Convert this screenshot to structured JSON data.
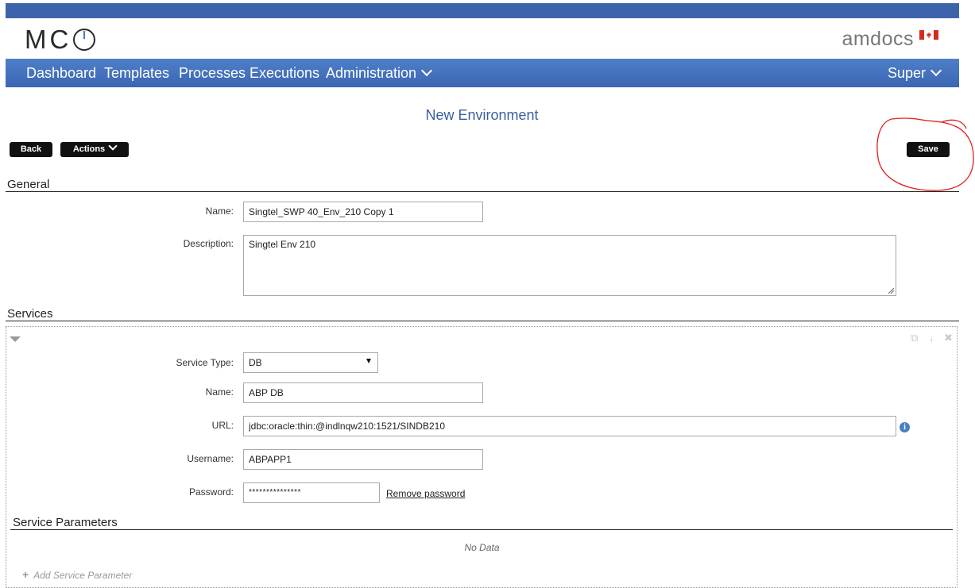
{
  "header": {
    "app_logo": "MCO",
    "brand": "amdocs",
    "brand_color": "#3d63ab",
    "flag_icon": "canada-flag-icon"
  },
  "nav": {
    "items": [
      {
        "label": "Dashboard"
      },
      {
        "label": "Templates"
      },
      {
        "label": "Processes"
      },
      {
        "label": "Executions"
      },
      {
        "label": "Administration"
      }
    ],
    "user": "Super"
  },
  "page": {
    "title": "New Environment",
    "back_label": "Back",
    "actions_label": "Actions",
    "save_label": "Save"
  },
  "general": {
    "heading": "General",
    "name_label": "Name:",
    "name_value": "Singtel_SWP 40_Env_210 Copy 1",
    "description_label": "Description:",
    "description_value": "Singtel Env 210"
  },
  "services": {
    "heading": "Services",
    "service_type_label": "Service Type:",
    "service_type_value": "DB",
    "name_label": "Name:",
    "name_value": "ABP DB",
    "url_label": "URL:",
    "url_value": "jdbc:oracle:thin:@indlnqw210:1521/SINDB210",
    "username_label": "Username:",
    "username_value": "ABPAPP1",
    "password_label": "Password:",
    "password_value": "***************",
    "remove_password": "Remove password",
    "params_heading": "Service Parameters",
    "no_data": "No Data",
    "add_param": "Add Service Parameter"
  }
}
